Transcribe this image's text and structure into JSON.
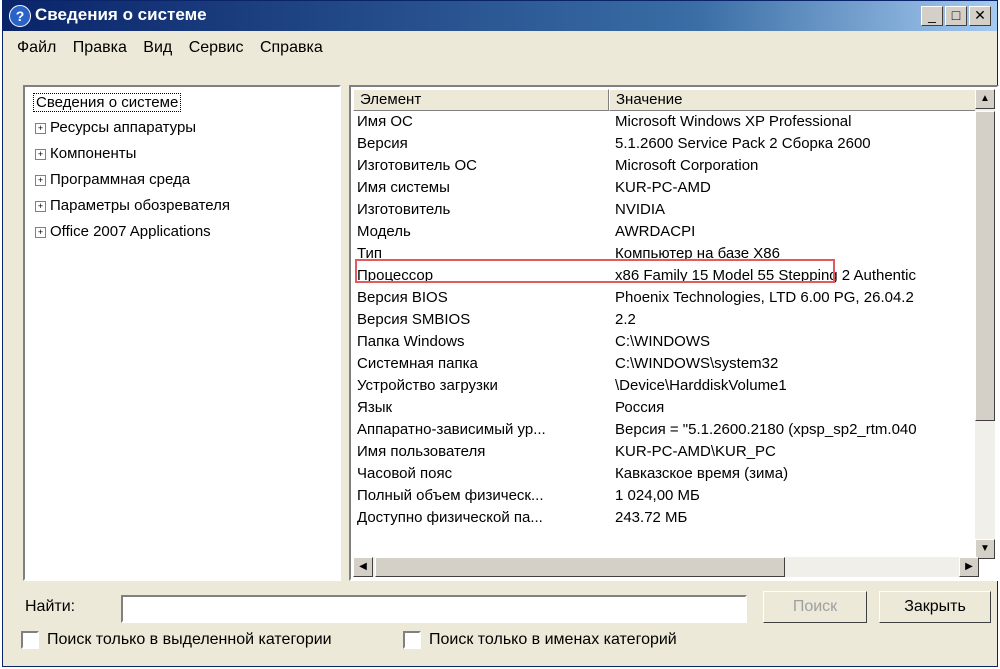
{
  "window": {
    "title": "Сведения о системе",
    "icon": "help-icon",
    "title_color": "#0a246a"
  },
  "menu": [
    "Файл",
    "Правка",
    "Вид",
    "Сервис",
    "Справка"
  ],
  "tree": {
    "root": "Сведения о системе",
    "items": [
      "Ресурсы аппаратуры",
      "Компоненты",
      "Программная среда",
      "Параметры обозревателя",
      "Office 2007 Applications"
    ]
  },
  "table": {
    "headers": [
      "Элемент",
      "Значение"
    ],
    "rows": [
      [
        "Имя ОС",
        "Microsoft Windows XP Professional"
      ],
      [
        "Версия",
        "5.1.2600 Service Pack 2 Сборка 2600"
      ],
      [
        "Изготовитель ОС",
        "Microsoft Corporation"
      ],
      [
        "Имя системы",
        "KUR-PC-AMD"
      ],
      [
        "Изготовитель",
        "NVIDIA"
      ],
      [
        "Модель",
        "AWRDACPI"
      ],
      [
        "Тип",
        "Компьютер на базе X86"
      ],
      [
        "Процессор",
        "x86 Family 15 Model 55 Stepping 2 Authentic"
      ],
      [
        "Версия BIOS",
        "Phoenix Technologies, LTD 6.00 PG, 26.04.2"
      ],
      [
        "Версия SMBIOS",
        "2.2"
      ],
      [
        "Папка Windows",
        "C:\\WINDOWS"
      ],
      [
        "Системная папка",
        "C:\\WINDOWS\\system32"
      ],
      [
        "Устройство загрузки",
        "\\Device\\HarddiskVolume1"
      ],
      [
        "Язык",
        "Россия"
      ],
      [
        "Аппаратно-зависимый ур...",
        "Версия = \"5.1.2600.2180 (xpsp_sp2_rtm.040"
      ],
      [
        "Имя пользователя",
        "KUR-PC-AMD\\KUR_PC"
      ],
      [
        "Часовой пояс",
        "Кавказское время (зима)"
      ],
      [
        "Полный объем физическ...",
        "1 024,00 МБ"
      ],
      [
        "Доступно физической па...",
        "243.72 МБ"
      ]
    ],
    "highlight_row": "Тип",
    "highlight_color": "#e25b5b"
  },
  "search": {
    "label": "Найти:",
    "value": "",
    "search_button": "Поиск",
    "close_button": "Закрыть",
    "checkbox1": "Поиск только в выделенной категории",
    "checkbox2": "Поиск только в именах категорий"
  }
}
